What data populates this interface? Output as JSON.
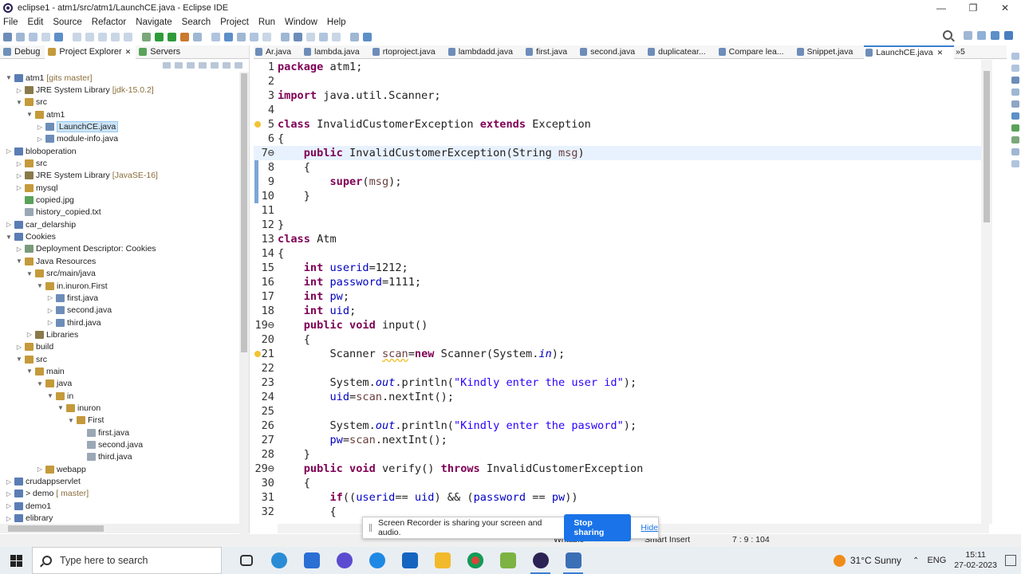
{
  "window": {
    "title": "eclipse1 - atm1/src/atm1/LaunchCE.java - Eclipse IDE",
    "controls": [
      "—",
      "❐",
      "✕"
    ]
  },
  "menu": [
    "File",
    "Edit",
    "Source",
    "Refactor",
    "Navigate",
    "Search",
    "Project",
    "Run",
    "Window",
    "Help"
  ],
  "left_tabs": [
    {
      "label": "Debug",
      "active": false
    },
    {
      "label": "Project Explorer",
      "active": true,
      "close": "✕"
    },
    {
      "label": "Servers",
      "active": false
    }
  ],
  "tree": [
    {
      "indent": 0,
      "twisty": "v",
      "label": "atm1",
      "deco": "[gits master]",
      "color": "#5b7db5"
    },
    {
      "indent": 1,
      "twisty": ">",
      "label": "JRE System Library",
      "deco": "[jdk-15.0.2]",
      "color": "#8a7a4a"
    },
    {
      "indent": 1,
      "twisty": "v",
      "label": "src",
      "color": "#c49a3a"
    },
    {
      "indent": 2,
      "twisty": "v",
      "label": "atm1",
      "color": "#c49a3a"
    },
    {
      "indent": 3,
      "twisty": ">",
      "label": "LaunchCE.java",
      "selected": true,
      "color": "#6d8db9"
    },
    {
      "indent": 3,
      "twisty": ">",
      "label": "module-info.java",
      "color": "#6d8db9"
    },
    {
      "indent": 0,
      "twisty": ">",
      "label": "bloboperation",
      "color": "#5b7db5"
    },
    {
      "indent": 1,
      "twisty": ">",
      "label": "src",
      "color": "#c49a3a"
    },
    {
      "indent": 1,
      "twisty": ">",
      "label": "JRE System Library",
      "deco": "[JavaSE-16]",
      "color": "#8a7a4a"
    },
    {
      "indent": 1,
      "twisty": ">",
      "label": "mysql",
      "color": "#c49a3a"
    },
    {
      "indent": 1,
      "twisty": "",
      "label": "copied.jpg",
      "color": "#5aa25a"
    },
    {
      "indent": 1,
      "twisty": "",
      "label": "history_copied.txt",
      "color": "#9aa7b5"
    },
    {
      "indent": 0,
      "twisty": ">",
      "label": "car_delarship",
      "color": "#5b7db5"
    },
    {
      "indent": 0,
      "twisty": "v",
      "label": "Cookies",
      "color": "#5b7db5"
    },
    {
      "indent": 1,
      "twisty": ">",
      "label": "Deployment Descriptor: Cookies",
      "color": "#7a9a7a"
    },
    {
      "indent": 1,
      "twisty": "v",
      "label": "Java Resources",
      "color": "#c49a3a"
    },
    {
      "indent": 2,
      "twisty": "v",
      "label": "src/main/java",
      "color": "#c49a3a"
    },
    {
      "indent": 3,
      "twisty": "v",
      "label": "in.inuron.First",
      "color": "#c49a3a"
    },
    {
      "indent": 4,
      "twisty": ">",
      "label": "first.java",
      "color": "#6d8db9"
    },
    {
      "indent": 4,
      "twisty": ">",
      "label": "second.java",
      "color": "#6d8db9"
    },
    {
      "indent": 4,
      "twisty": ">",
      "label": "third.java",
      "color": "#6d8db9"
    },
    {
      "indent": 2,
      "twisty": ">",
      "label": "Libraries",
      "color": "#8a7a4a"
    },
    {
      "indent": 1,
      "twisty": ">",
      "label": "build",
      "color": "#c49a3a"
    },
    {
      "indent": 1,
      "twisty": "v",
      "label": "src",
      "color": "#c49a3a"
    },
    {
      "indent": 2,
      "twisty": "v",
      "label": "main",
      "color": "#c49a3a"
    },
    {
      "indent": 3,
      "twisty": "v",
      "label": "java",
      "color": "#c49a3a"
    },
    {
      "indent": 4,
      "twisty": "v",
      "label": "in",
      "color": "#c49a3a"
    },
    {
      "indent": 5,
      "twisty": "v",
      "label": "inuron",
      "color": "#c49a3a"
    },
    {
      "indent": 6,
      "twisty": "v",
      "label": "First",
      "color": "#c49a3a"
    },
    {
      "indent": 7,
      "twisty": "",
      "label": "first.java",
      "color": "#9aa7b5"
    },
    {
      "indent": 7,
      "twisty": "",
      "label": "second.java",
      "color": "#9aa7b5"
    },
    {
      "indent": 7,
      "twisty": "",
      "label": "third.java",
      "color": "#9aa7b5"
    },
    {
      "indent": 3,
      "twisty": ">",
      "label": "webapp",
      "color": "#c49a3a"
    },
    {
      "indent": 0,
      "twisty": ">",
      "label": "crudappservlet",
      "color": "#5b7db5"
    },
    {
      "indent": 0,
      "twisty": ">",
      "label": "> demo",
      "deco": "[ master]",
      "color": "#5b7db5"
    },
    {
      "indent": 0,
      "twisty": ">",
      "label": "demo1",
      "color": "#5b7db5"
    },
    {
      "indent": 0,
      "twisty": ">",
      "label": "elibrary",
      "color": "#5b7db5"
    }
  ],
  "editor_tabs": [
    {
      "label": "Ar.java"
    },
    {
      "label": "lambda.java"
    },
    {
      "label": "rtoproject.java"
    },
    {
      "label": "lambdadd.java"
    },
    {
      "label": "first.java"
    },
    {
      "label": "second.java"
    },
    {
      "label": "duplicatear..."
    },
    {
      "label": "Compare lea..."
    },
    {
      "label": "Snippet.java"
    },
    {
      "label": "LaunchCE.java",
      "active": true,
      "close": "✕"
    },
    {
      "label": "»5"
    }
  ],
  "code": [
    {
      "n": "1",
      "html": "<span class='k'>package</span> atm1;"
    },
    {
      "n": "2",
      "html": ""
    },
    {
      "n": "3",
      "html": "<span class='k'>import</span> java.util.Scanner;"
    },
    {
      "n": "4",
      "html": ""
    },
    {
      "n": "5",
      "html": "<span class='k'>class</span> InvalidCustomerException <span class='k'>extends</span> Exception",
      "warn": true
    },
    {
      "n": "6",
      "html": "{"
    },
    {
      "n": "7⊖",
      "html": "    <span class='k'>public</span> InvalidCustomerException(String <span class='v'>msg</span>)",
      "current": true
    },
    {
      "n": "8",
      "html": "    {"
    },
    {
      "n": "9",
      "html": "        <span class='k'>super</span>(<span class='v'>msg</span>);"
    },
    {
      "n": "10",
      "html": "    }"
    },
    {
      "n": "11",
      "html": ""
    },
    {
      "n": "12",
      "html": "}"
    },
    {
      "n": "13",
      "html": "<span class='k'>class</span> Atm"
    },
    {
      "n": "14",
      "html": "{"
    },
    {
      "n": "15",
      "html": "    <span class='k'>int</span> <span class='st' style='font-style:normal'>userid</span>=1212;"
    },
    {
      "n": "16",
      "html": "    <span class='k'>int</span> <span class='st' style='font-style:normal'>password</span>=1111;"
    },
    {
      "n": "17",
      "html": "    <span class='k'>int</span> <span class='st' style='font-style:normal'>pw</span>;"
    },
    {
      "n": "18",
      "html": "    <span class='k'>int</span> <span class='st' style='font-style:normal'>uid</span>;"
    },
    {
      "n": "19⊖",
      "html": "    <span class='k'>public</span> <span class='k'>void</span> input()"
    },
    {
      "n": "20",
      "html": "    {"
    },
    {
      "n": "21",
      "html": "        Scanner <span class='v' style='text-decoration:underline wavy #f2c335'>scan</span>=<span class='k'>new</span> Scanner(System.<span class='st'>in</span>);",
      "warn": true
    },
    {
      "n": "22",
      "html": ""
    },
    {
      "n": "23",
      "html": "        System.<span class='st'>out</span>.println(<span class='s'>\"Kindly enter the user id\"</span>);"
    },
    {
      "n": "24",
      "html": "        <span class='st' style='font-style:normal'>uid</span>=<span class='v'>scan</span>.nextInt();"
    },
    {
      "n": "25",
      "html": ""
    },
    {
      "n": "26",
      "html": "        System.<span class='st'>out</span>.println(<span class='s'>\"Kindly enter the pasword\"</span>);"
    },
    {
      "n": "27",
      "html": "        <span class='st' style='font-style:normal'>pw</span>=<span class='v'>scan</span>.nextInt();"
    },
    {
      "n": "28",
      "html": "    }"
    },
    {
      "n": "29⊖",
      "html": "    <span class='k'>public</span> <span class='k'>void</span> verify() <span class='k'>throws</span> InvalidCustomerException"
    },
    {
      "n": "30",
      "html": "    {"
    },
    {
      "n": "31",
      "html": "        <span class='k'>if</span>((<span class='st' style='font-style:normal'>userid</span>== <span class='st' style='font-style:normal'>uid</span>) &amp;&amp; (<span class='st' style='font-style:normal'>password</span> == <span class='st' style='font-style:normal'>pw</span>))"
    },
    {
      "n": "32",
      "html": "        {"
    }
  ],
  "status": {
    "writable": "Writable",
    "insert_mode": "Smart Insert",
    "position": "7 : 9 : 104"
  },
  "share_bar": {
    "message": "Screen Recorder is sharing your screen and audio.",
    "stop_label": "Stop sharing",
    "hide_label": "Hide"
  },
  "taskbar": {
    "search_placeholder": "Type here to search",
    "weather": "31°C  Sunny",
    "lang": "ENG",
    "time": "15:11",
    "date": "27-02-2023"
  },
  "colors": {
    "keyword": "#7f0055",
    "string": "#2a00ff",
    "field": "#0000c0",
    "accent": "#3b7fd1",
    "stop_button": "#1a73e8"
  }
}
